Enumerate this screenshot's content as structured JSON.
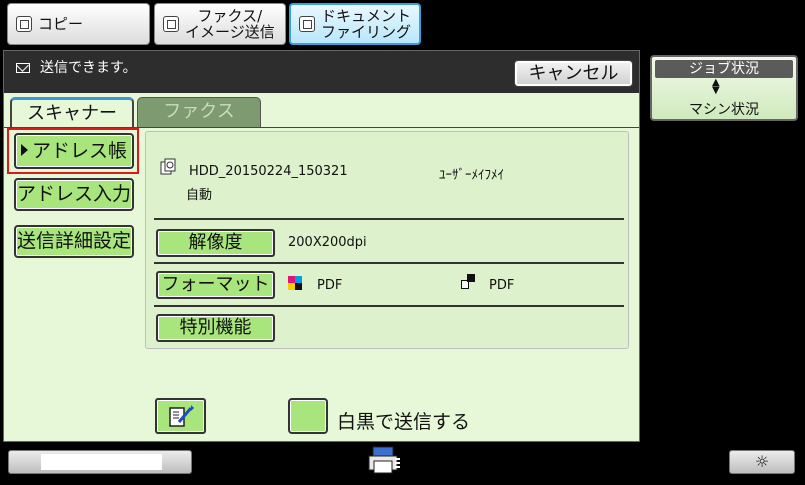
{
  "top_tabs": [
    {
      "label": "コピー"
    },
    {
      "label": "ファクス/\nイメージ送信"
    },
    {
      "label": "ドキュメント\nファイリング"
    }
  ],
  "status": {
    "message": "送信できます。",
    "cancel_label": "キャンセル"
  },
  "sub_tabs": {
    "scanner": "スキャナー",
    "fax": "ファクス"
  },
  "side_buttons": {
    "address_book": "アドレス帳",
    "address_input": "アドレス入力",
    "send_detail": "送信詳細設定"
  },
  "file": {
    "name": "HDD_20150224_150321",
    "user": "ﾕｰｻﾞｰﾒｲﾌﾒｲ",
    "auto": "自動"
  },
  "features": {
    "resolution_label": "解像度",
    "resolution_value": "200X200dpi",
    "format_label": "フォーマット",
    "color_format": "PDF",
    "mono_format": "PDF",
    "special_label": "特別機能"
  },
  "bw_send_label": "白黒で送信する",
  "job_status": {
    "top": "ジョブ状況",
    "bottom": "マシン状況"
  },
  "colors": {
    "panel_bg": "#e6f8d8",
    "button_green": "#a8e67d",
    "highlight_red": "#e01818",
    "active_tab_blue": "#3aa0d8"
  },
  "icons": [
    "copy-icon",
    "fax-image-icon",
    "document-filing-icon",
    "mail-icon",
    "file-icon",
    "color-icon",
    "mono-icon",
    "edit-icon",
    "printer-icon",
    "brightness-icon"
  ]
}
